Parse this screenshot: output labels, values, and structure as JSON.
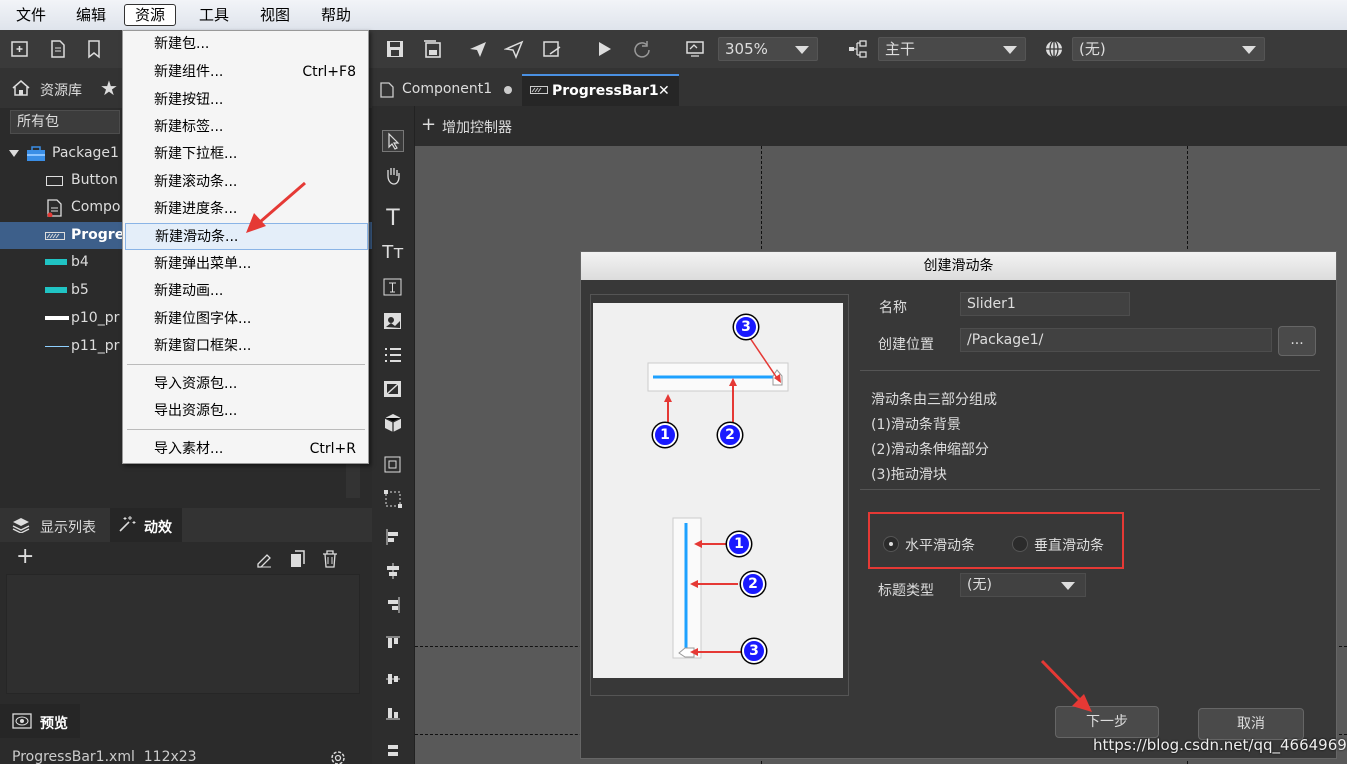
{
  "menubar": {
    "items": [
      "文件",
      "编辑",
      "资源",
      "工具",
      "视图",
      "帮助"
    ]
  },
  "resource_menu": {
    "items": [
      {
        "label": "新建包...",
        "shortcut": ""
      },
      {
        "label": "新建组件...",
        "shortcut": "Ctrl+F8"
      },
      {
        "label": "新建按钮...",
        "shortcut": ""
      },
      {
        "label": "新建标签...",
        "shortcut": ""
      },
      {
        "label": "新建下拉框...",
        "shortcut": ""
      },
      {
        "label": "新建滚动条...",
        "shortcut": ""
      },
      {
        "label": "新建进度条...",
        "shortcut": ""
      },
      {
        "label": "新建滑动条...",
        "shortcut": ""
      },
      {
        "label": "新建弹出菜单...",
        "shortcut": ""
      },
      {
        "label": "新建动画...",
        "shortcut": ""
      },
      {
        "label": "新建位图字体...",
        "shortcut": ""
      },
      {
        "label": "新建窗口框架...",
        "shortcut": ""
      }
    ],
    "io_items": [
      {
        "label": "导入资源包...",
        "shortcut": ""
      },
      {
        "label": "导出资源包...",
        "shortcut": ""
      }
    ],
    "import_item": {
      "label": "导入素材...",
      "shortcut": "Ctrl+R"
    },
    "highlighted_item": "新建滑动条..."
  },
  "toolbar": {
    "zoom": "305%",
    "branch": "主干",
    "language": "(无)"
  },
  "tabs": [
    {
      "label": "Component1"
    },
    {
      "label": "ProgressBar1"
    }
  ],
  "controller_bar": {
    "add_label": "增加控制器"
  },
  "library": {
    "tab_label": "资源库",
    "filter": "所有包",
    "tree": [
      {
        "label": "Package1"
      },
      {
        "label": "Button"
      },
      {
        "label": "Compo"
      },
      {
        "label": "Progres"
      },
      {
        "label": "b4"
      },
      {
        "label": "b5"
      },
      {
        "label": "p10_pr"
      },
      {
        "label": "p11_pr"
      }
    ]
  },
  "lower_panel": {
    "tab_display": "显示列表",
    "tab_effects": "动效"
  },
  "preview": {
    "title": "预览",
    "file_info": "ProgressBar1.xml  112x23"
  },
  "dialog": {
    "title": "创建滑动条",
    "name_label": "名称",
    "name_value": "Slider1",
    "location_label": "创建位置",
    "location_value": "/Package1/",
    "browse_label": "...",
    "desc_lines": [
      "滑动条由三部分组成",
      "(1)滑动条背景",
      "(2)滑动条伸缩部分",
      "(3)拖动滑块"
    ],
    "radio_horizontal": "水平滑动条",
    "radio_vertical": "垂直滑动条",
    "selected_orientation": "水平滑动条",
    "title_type_label": "标题类型",
    "title_type_value": "(无)",
    "next_button": "下一步",
    "cancel_button": "取消",
    "callouts": [
      "1",
      "2",
      "3"
    ]
  },
  "watermark": "https://blog.csdn.net/qq_46649692",
  "colors": {
    "accent": "#4a90e2",
    "selection": "#3d5f8a",
    "annotation_red": "#e53935",
    "callout_blue": "#1a1aff"
  }
}
